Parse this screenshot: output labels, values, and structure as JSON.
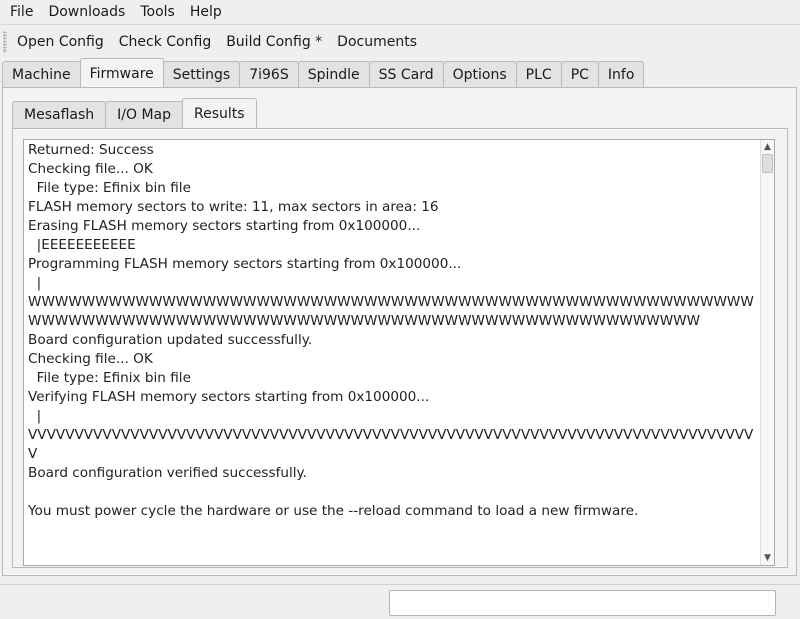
{
  "menubar": {
    "items": [
      "File",
      "Downloads",
      "Tools",
      "Help"
    ]
  },
  "toolbar": {
    "open_config": "Open Config",
    "check_config": "Check Config",
    "build_config": "Build Config *",
    "documents": "Documents"
  },
  "tabs": [
    "Machine",
    "Firmware",
    "Settings",
    "7i96S",
    "Spindle",
    "SS Card",
    "Options",
    "PLC",
    "PC",
    "Info"
  ],
  "active_tab": "Firmware",
  "subtabs": [
    "Mesaflash",
    "I/O Map",
    "Results"
  ],
  "active_subtab": "Results",
  "results": {
    "text": "Returned: Success\nChecking file... OK\n  File type: Efinix bin file\nFLASH memory sectors to write: 11, max sectors in area: 16\nErasing FLASH memory sectors starting from 0x100000...\n  |EEEEEEEEEEE\nProgramming FLASH memory sectors starting from 0x100000...\n  |\nWWWWWWWWWWWWWWWWWWWWWWWWWWWWWWWWWWWWWWWWWWWWWWWWWWWWWWWWWWWWWWWWWWWWWWWWWWWWWWWWWWWWWWWWWWWWWWWWWWWWWWWW\nBoard configuration updated successfully.\nChecking file... OK\n  File type: Efinix bin file\nVerifying FLASH memory sectors starting from 0x100000...\n  |\nVVVVVVVVVVVVVVVVVVVVVVVVVVVVVVVVVVVVVVVVVVVVVVVVVVVVVVVVVVVVVVVVVVVVVVVVVVVVVVV\nBoard configuration verified successfully.\n\nYou must power cycle the hardware or use the --reload command to load a new firmware."
  },
  "status": {
    "value": ""
  }
}
